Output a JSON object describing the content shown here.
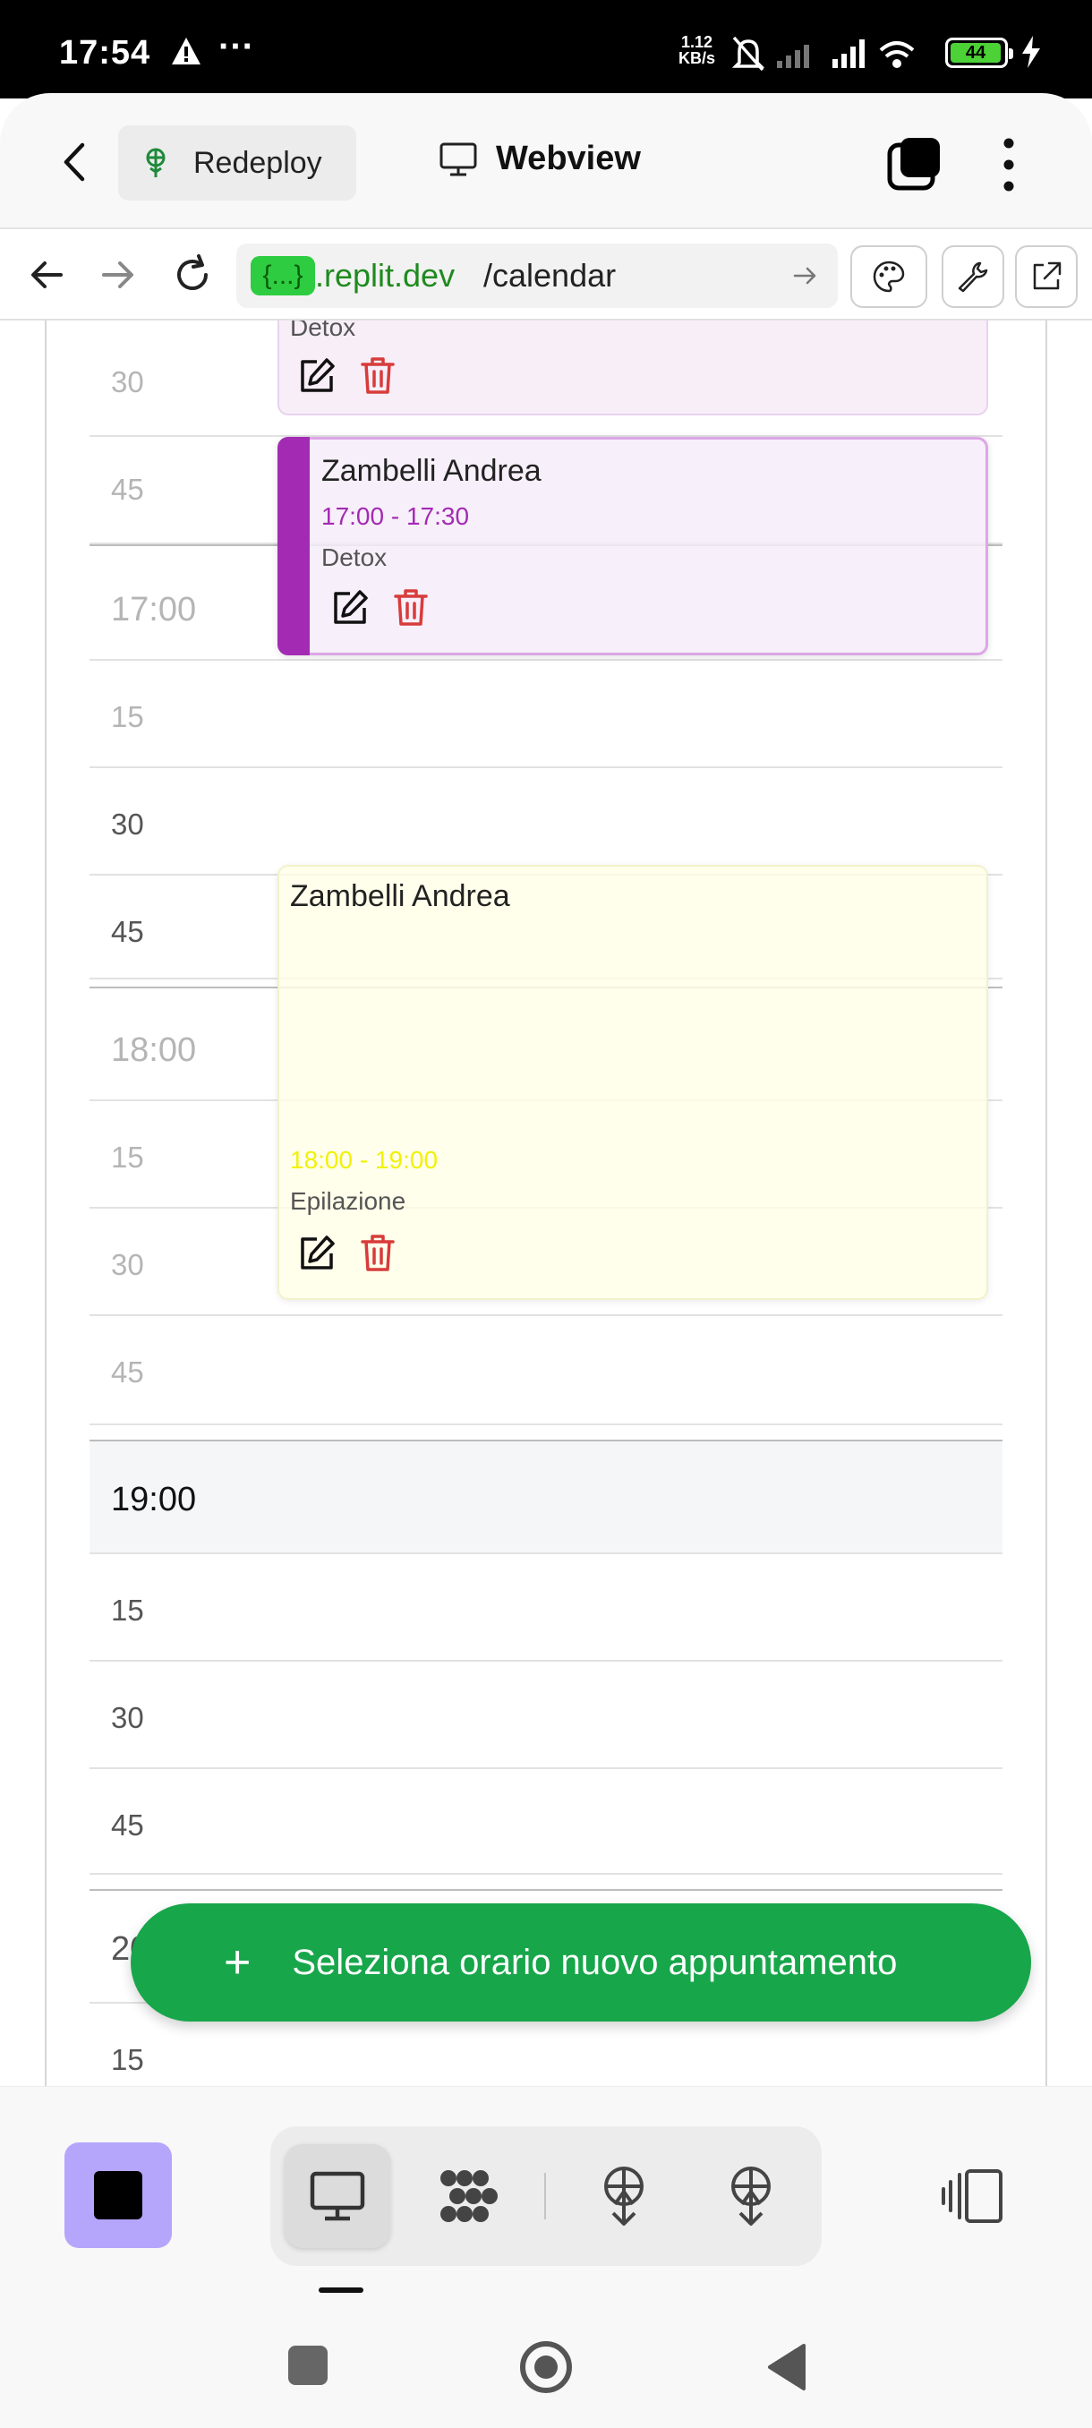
{
  "status_bar": {
    "time": "17:54",
    "network_speed_value": "1.12",
    "network_speed_unit": "KB/s",
    "battery_level": "44"
  },
  "header": {
    "redeploy_label": "Redeploy",
    "title": "Webview"
  },
  "url_bar": {
    "brackets": "{...}",
    "host": ".replit.dev",
    "path": "/calendar"
  },
  "calendar": {
    "rows": [
      {
        "label": "30",
        "state": "past"
      },
      {
        "label": "45",
        "state": "past"
      },
      {
        "label": "17:00",
        "state": "past"
      },
      {
        "label": "15",
        "state": "past"
      },
      {
        "label": "30",
        "state": "future"
      },
      {
        "label": "45",
        "state": "future"
      },
      {
        "label": "18:00",
        "state": "past"
      },
      {
        "label": "15",
        "state": "past"
      },
      {
        "label": "30",
        "state": "past"
      },
      {
        "label": "45",
        "state": "past"
      },
      {
        "label": "19:00",
        "state": "current"
      },
      {
        "label": "15",
        "state": "future"
      },
      {
        "label": "30",
        "state": "future"
      },
      {
        "label": "45",
        "state": "future"
      },
      {
        "label": "20:00",
        "state": "future"
      },
      {
        "label": "15",
        "state": "future"
      }
    ],
    "events": [
      {
        "service": "Detox",
        "color": "#a32bb3"
      },
      {
        "name": "Zambelli Andrea",
        "time": "17:00 - 17:30",
        "service": "Detox",
        "color": "#a32bb3"
      },
      {
        "name": "Zambelli Andrea",
        "time": "18:00 - 19:00",
        "service": "Epilazione",
        "color": "#f1f10a"
      }
    ]
  },
  "fab": {
    "label": "Seleziona orario nuovo appuntamento"
  },
  "colors": {
    "accent_green": "#17a64a",
    "stop_button": "#b5a6fb"
  }
}
